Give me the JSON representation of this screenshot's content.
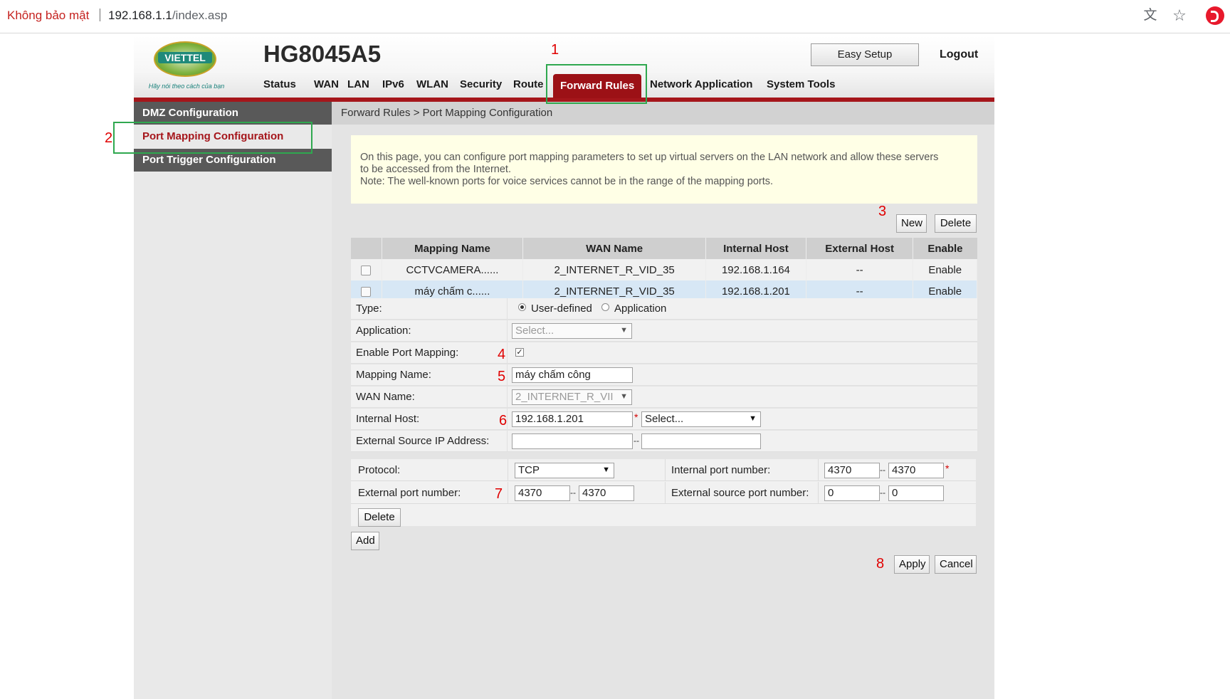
{
  "browser": {
    "security_label": "Không bảo mật",
    "separator": "|",
    "url_host": "192.168.1.1",
    "url_path": "/index.asp"
  },
  "header": {
    "logo_text": "VIETTEL",
    "logo_slogan": "Hãy nói theo cách của bạn",
    "model": "HG8045A5",
    "easy_setup_label": "Easy Setup",
    "logout_label": "Logout",
    "nav": [
      "Status",
      "WAN",
      "LAN",
      "IPv6",
      "WLAN",
      "Security",
      "Route",
      "Forward Rules",
      "Network Application",
      "System Tools"
    ],
    "active_nav": "Forward Rules"
  },
  "sidebar": {
    "items": [
      "DMZ Configuration",
      "Port Mapping Configuration",
      "Port Trigger Configuration"
    ],
    "selected": "Port Mapping Configuration"
  },
  "breadcrumb": "Forward Rules > Port Mapping Configuration",
  "info": {
    "line1": "On this page, you can configure port mapping parameters to set up virtual servers on the LAN network and allow these servers",
    "line2": "to be accessed from the Internet.",
    "line3": "Note: The well-known ports for voice services cannot be in the range of the mapping ports."
  },
  "table_actions": {
    "new_label": "New",
    "delete_label": "Delete"
  },
  "table": {
    "columns": [
      "Mapping Name",
      "WAN Name",
      "Internal Host",
      "External Host",
      "Enable"
    ],
    "rows": [
      {
        "mapping_name": "CCTVCAMERA......",
        "wan_name": "2_INTERNET_R_VID_35",
        "internal_host": "192.168.1.164",
        "external_host": "--",
        "enable": "Enable"
      },
      {
        "mapping_name": "máy chấm c......",
        "wan_name": "2_INTERNET_R_VID_35",
        "internal_host": "192.168.1.201",
        "external_host": "--",
        "enable": "Enable"
      }
    ],
    "selected_row": 1
  },
  "form": {
    "type_label": "Type:",
    "type_option_user": "User-defined",
    "type_option_app": "Application",
    "type_selected": "User-defined",
    "application_label": "Application:",
    "application_value": "Select...",
    "enable_label": "Enable Port Mapping:",
    "enable_checked": true,
    "mapping_name_label": "Mapping Name:",
    "mapping_name_value": "máy chấm công",
    "wan_name_label": "WAN Name:",
    "wan_name_value": "2_INTERNET_R_VII",
    "internal_host_label": "Internal Host:",
    "internal_host_value": "192.168.1.201",
    "internal_host_select": "Select...",
    "external_src_ip_label": "External Source IP Address:",
    "external_src_ip_start": "",
    "external_src_ip_end": "",
    "required_mark": "*",
    "range_sep": "--"
  },
  "ports": {
    "protocol_label": "Protocol:",
    "protocol_value": "TCP",
    "internal_port_label": "Internal port number:",
    "internal_port_start": "4370",
    "internal_port_end": "4370",
    "external_port_label": "External port number:",
    "external_port_start": "4370",
    "external_port_end": "4370",
    "external_src_port_label": "External source port number:",
    "external_src_port_start": "0",
    "external_src_port_end": "0",
    "delete_label": "Delete"
  },
  "footer": {
    "add_label": "Add",
    "apply_label": "Apply",
    "cancel_label": "Cancel"
  },
  "annotations": [
    "1",
    "2",
    "3",
    "4",
    "5",
    "6",
    "7",
    "8"
  ],
  "colors": {
    "brand_red": "#a5161b",
    "sidebar_dark": "#595959",
    "annotation_red": "#e00000",
    "highlight_green": "#2fa84f",
    "info_bg": "#ffffe6"
  }
}
